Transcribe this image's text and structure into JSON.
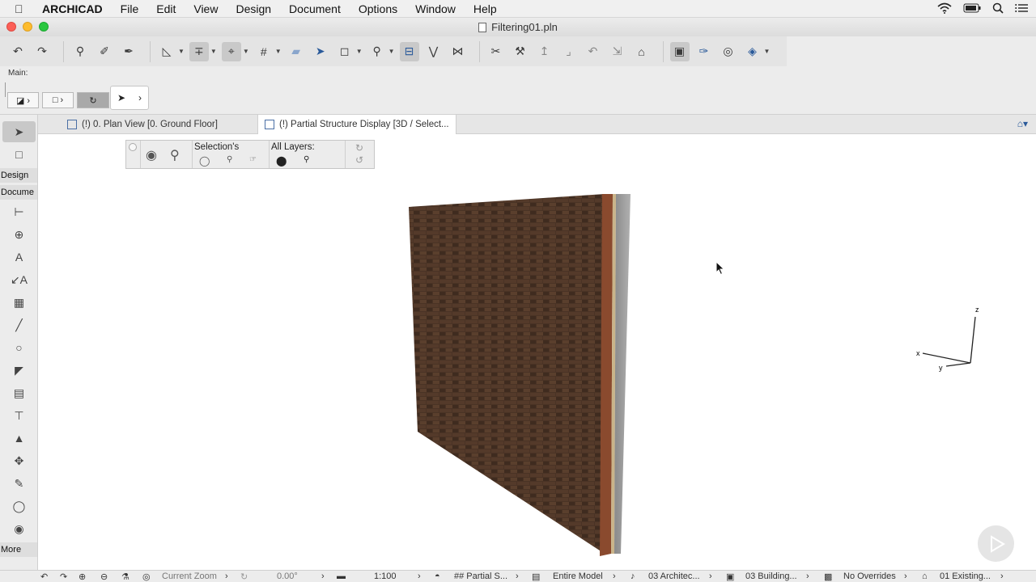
{
  "menubar": {
    "app": "ARCHICAD",
    "items": [
      "File",
      "Edit",
      "View",
      "Design",
      "Document",
      "Options",
      "Window",
      "Help"
    ]
  },
  "window": {
    "title": "Filtering01.pln"
  },
  "infobox": {
    "main_label": "Main:"
  },
  "toolbox": {
    "design_label": "Design",
    "document_label": "Docume",
    "more_label": "More"
  },
  "tabs": [
    {
      "label": "(!) 0. Plan View [0. Ground Floor]"
    },
    {
      "label": "(!) Partial Structure Display [3D / Select..."
    }
  ],
  "layer_palette": {
    "selection_label": "Selection's",
    "all_layers_label": "All Layers:"
  },
  "axes": {
    "z": "z",
    "x": "x",
    "y": "y"
  },
  "statusbar": {
    "zoom": "Current Zoom",
    "angle": "0.00°",
    "scale": "1:100",
    "structure": "## Partial S...",
    "model": "Entire Model",
    "pen_set": "03 Architec...",
    "layer_combo": "03 Building...",
    "overrides": "No Overrides",
    "renovation": "01 Existing..."
  },
  "colors": {
    "brick": "#4a3325",
    "brick_edge": "#8a4a2e",
    "concrete": "#9a9a9a"
  }
}
